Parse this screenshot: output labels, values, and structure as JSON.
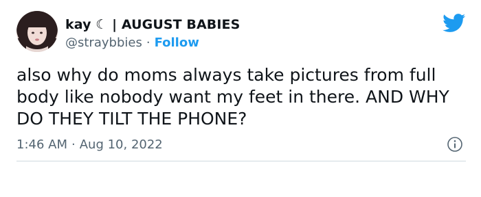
{
  "tweet": {
    "author": {
      "display_name": "kay ☾ | AUGUST BABIES",
      "handle": "@straybbies",
      "separator": "·",
      "follow_label": "Follow"
    },
    "text": "also why do moms always take pictures from full body like nobody want my feet in there. AND WHY DO THEY TILT THE PHONE?",
    "time": "1:46 AM",
    "meta_separator": "·",
    "date": "Aug 10, 2022"
  },
  "icons": {
    "brand": "twitter-bird-icon",
    "info": "info-icon"
  },
  "colors": {
    "accent": "#1d9bf0",
    "text": "#0f1419",
    "secondary": "#536471",
    "divider": "#cfd9de"
  }
}
